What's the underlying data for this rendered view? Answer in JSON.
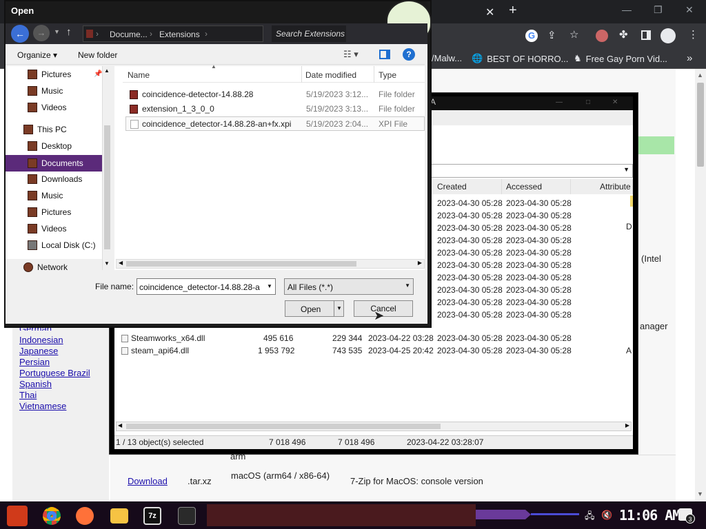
{
  "browser": {
    "tab_close": "✕",
    "new_tab": "+",
    "bookmarks": [
      "/Malw...",
      "BEST OF HORRO...",
      "Free Gay Porn Vid..."
    ],
    "more": "»"
  },
  "page": {
    "languages": [
      "German",
      "Indonesian",
      "Japanese",
      "Persian",
      "Portuguese Brazil",
      "Spanish",
      "Thai",
      "Vietnamese"
    ],
    "intel_text": "(Intel",
    "manager_text": "anager",
    "arm_text": "arm",
    "download_link": "Download",
    "ext": ".tar.xz",
    "platform": "macOS (arm64 / x86-64)",
    "description": "7-Zip for MacOS: console version"
  },
  "zip": {
    "title_frag": "A",
    "columns": [
      "Created",
      "Accessed",
      "Attribute"
    ],
    "created_rows": [
      "2023-04-30 05:28",
      "2023-04-30 05:28",
      "2023-04-30 05:28",
      "2023-04-30 05:28",
      "2023-04-30 05:28",
      "2023-04-30 05:28",
      "2023-04-30 05:28",
      "2023-04-30 05:28",
      "2023-04-30 05:28",
      "2023-04-30 05:28"
    ],
    "accessed_rows": [
      "2023-04-30 05:28",
      "2023-04-30 05:28",
      "2023-04-30 05:28",
      "2023-04-30 05:28",
      "2023-04-30 05:28",
      "2023-04-30 05:28",
      "2023-04-30 05:28",
      "2023-04-30 05:28",
      "2023-04-30 05:28",
      "2023-04-30 05:28"
    ],
    "attr_frag": [
      "D"
    ],
    "files": [
      {
        "name": "Steamworks_x64.dll",
        "size": "495 616",
        "packed": "229 344",
        "modified": "2023-04-22 03:28",
        "created": "2023-04-30 05:28",
        "accessed": "2023-04-30 05:28",
        "attr": ""
      },
      {
        "name": "steam_api64.dll",
        "size": "1 953 792",
        "packed": "743 535",
        "modified": "2023-04-25 20:42",
        "created": "2023-04-30 05:28",
        "accessed": "2023-04-30 05:28",
        "attr": "A"
      }
    ],
    "status": {
      "selected": "1 / 13 object(s) selected",
      "size": "7 018 496",
      "packed": "7 018 496",
      "date": "2023-04-22 03:28:07"
    }
  },
  "dialog": {
    "title": "Open",
    "breadcrumb": [
      "Docume...",
      "Extensions"
    ],
    "search_placeholder": "Search Extensions",
    "organize": "Organize ▾",
    "new_folder": "New folder",
    "nav": [
      {
        "label": "Pictures"
      },
      {
        "label": "Music"
      },
      {
        "label": "Videos"
      },
      {
        "label": "This PC"
      },
      {
        "label": "Desktop"
      },
      {
        "label": "Documents"
      },
      {
        "label": "Downloads"
      },
      {
        "label": "Music"
      },
      {
        "label": "Pictures"
      },
      {
        "label": "Videos"
      },
      {
        "label": "Local Disk (C:)"
      },
      {
        "label": "Network"
      }
    ],
    "columns": [
      "Name",
      "Date modified",
      "Type"
    ],
    "files": [
      {
        "name": "coincidence-detector-14.88.28",
        "date": "5/19/2023 3:12...",
        "type": "File folder"
      },
      {
        "name": "extension_1_3_0_0",
        "date": "5/19/2023 3:13...",
        "type": "File folder"
      },
      {
        "name": "coincidence_detector-14.88.28-an+fx.xpi",
        "date": "5/19/2023 2:04...",
        "type": "XPI File"
      }
    ],
    "filename_label": "File name:",
    "filename_value": "coincidence_detector-14.88.28-a",
    "filetype": "All Files (*.*)",
    "open": "Open",
    "cancel": "Cancel"
  },
  "taskbar": {
    "clock": "11:06 AM",
    "notif_count": "3"
  }
}
